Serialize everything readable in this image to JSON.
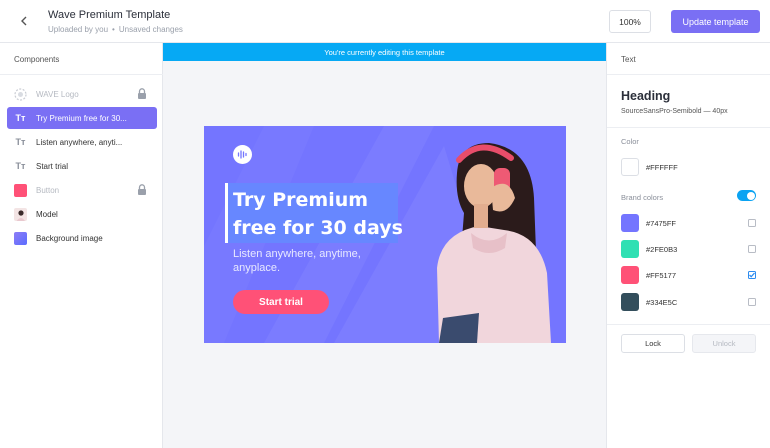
{
  "header": {
    "title": "Wave Premium Template",
    "subtitle_owner": "Uploaded by you",
    "subtitle_sep": "•",
    "subtitle_status": "Unsaved changes",
    "zoom": "100%",
    "update_label": "Update template"
  },
  "sidebar": {
    "title": "Components",
    "items": [
      {
        "label": "WAVE Logo",
        "icon": "wave-logo-icon",
        "locked": true,
        "dim": true
      },
      {
        "label": "Try Premium free for 30...",
        "icon": "text-icon",
        "locked": false,
        "selected": true
      },
      {
        "label": "Listen anywhere, anyti...",
        "icon": "text-icon",
        "locked": false
      },
      {
        "label": "Start trial",
        "icon": "text-icon",
        "locked": false
      },
      {
        "label": "Button",
        "icon": "button-swatch-icon",
        "locked": true,
        "dim": true
      },
      {
        "label": "Model",
        "icon": "image-thumbnail-icon",
        "locked": false
      },
      {
        "label": "Background image",
        "icon": "background-swatch-icon",
        "locked": false
      }
    ]
  },
  "editor": {
    "banner": "You're currently editing this template"
  },
  "artwork": {
    "headline_line1": "Try Premium",
    "headline_line2": "free for 30 days",
    "subline": "Listen anywhere, anytime, anyplace.",
    "cta": "Start trial"
  },
  "inspector": {
    "title": "Text",
    "element": "Heading",
    "font": "SourceSansPro-Semibold — 40px",
    "color_label": "Color",
    "current_color": "#FFFFFF",
    "brand_label": "Brand colors",
    "brand_enabled": true,
    "brand_colors": [
      {
        "hex": "#7475FF",
        "checked": false
      },
      {
        "hex": "#2FE0B3",
        "checked": false
      },
      {
        "hex": "#FF5177",
        "checked": true
      },
      {
        "hex": "#334E5C",
        "checked": false
      }
    ],
    "lock_label": "Lock",
    "unlock_label": "Unlock"
  },
  "colors": {
    "accent": "#7a6ff4",
    "banner": "#06a9f4",
    "art_bg": "#7475ff",
    "cta": "#ff5177"
  }
}
